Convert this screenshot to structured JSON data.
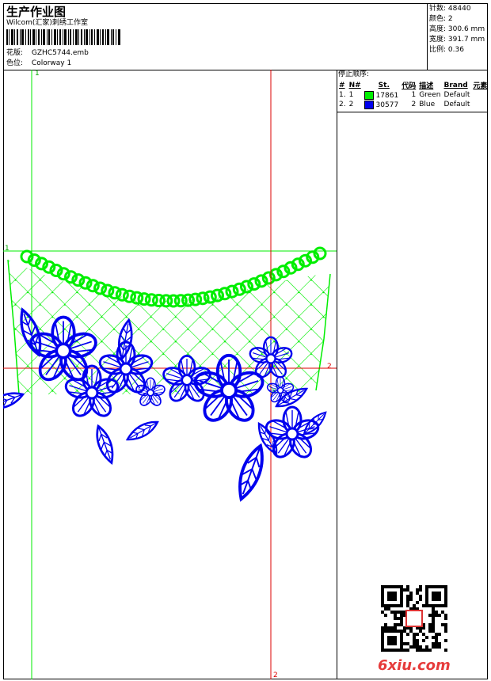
{
  "header": {
    "title": "生产作业图",
    "company": "Wilcom(汇家)刺绣工作室",
    "design_label": "花版:",
    "design_value": "GZHC5744.emb",
    "colorway_label": "色位:",
    "colorway_value": "Colorway 1"
  },
  "stats": [
    {
      "label": "针数:",
      "value": "48440"
    },
    {
      "label": "颜色:",
      "value": "2"
    },
    {
      "label": "高度:",
      "value": "300.6 mm"
    },
    {
      "label": "宽度:",
      "value": "391.7 mm"
    },
    {
      "label": "比例:",
      "value": "0.36"
    }
  ],
  "sequence": {
    "title": "停止顺序:",
    "columns": [
      "#",
      "N#",
      "St.",
      "代码",
      "描述",
      "Brand",
      "元素"
    ],
    "rows": [
      {
        "num": "1.",
        "n": "1",
        "color": "#00ee00",
        "stitches": "17861",
        "code": "1",
        "desc": "Green",
        "brand": "Default"
      },
      {
        "num": "2.",
        "n": "2",
        "color": "#0000ee",
        "stitches": "30577",
        "code": "2",
        "desc": "Blue",
        "brand": "Default"
      }
    ]
  },
  "guides": {
    "green_top": "1",
    "green_left": "1",
    "red_right": "2",
    "red_bottom": "2"
  },
  "watermark": "6xiu.com",
  "colors": {
    "green": "#00ee00",
    "blue": "#0000ee",
    "red_guide": "#dd0000"
  }
}
